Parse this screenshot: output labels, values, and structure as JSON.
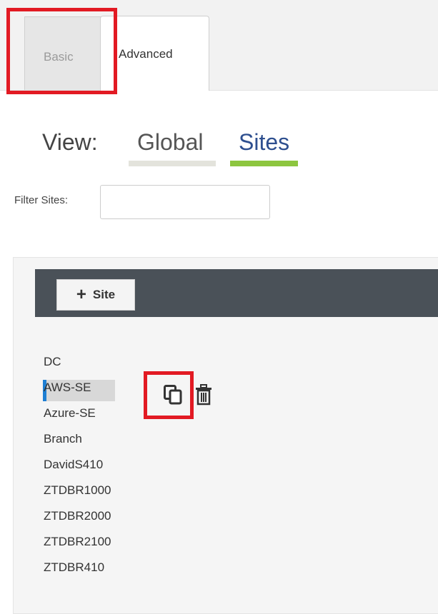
{
  "tabs": {
    "basic": "Basic",
    "advanced": "Advanced"
  },
  "view": {
    "label": "View:",
    "global": "Global",
    "sites": "Sites"
  },
  "filter": {
    "label": "Filter Sites:",
    "value": ""
  },
  "toolbar": {
    "add_site": "Site"
  },
  "sites": [
    "DC",
    "AWS-SE",
    "Azure-SE",
    "Branch",
    "DavidS410",
    "ZTDBR1000",
    "ZTDBR2000",
    "ZTDBR2100",
    "ZTDBR410"
  ],
  "selected_site": "AWS-SE",
  "icons": {
    "copy": "copy-icon",
    "trash": "trash-icon",
    "plus": "plus-icon"
  },
  "colors": {
    "highlight": "#e21a23",
    "accent_green": "#8dc63f",
    "link_blue": "#2e4f8f",
    "toolbar": "#4a5158",
    "selection": "#1e7fd3"
  }
}
